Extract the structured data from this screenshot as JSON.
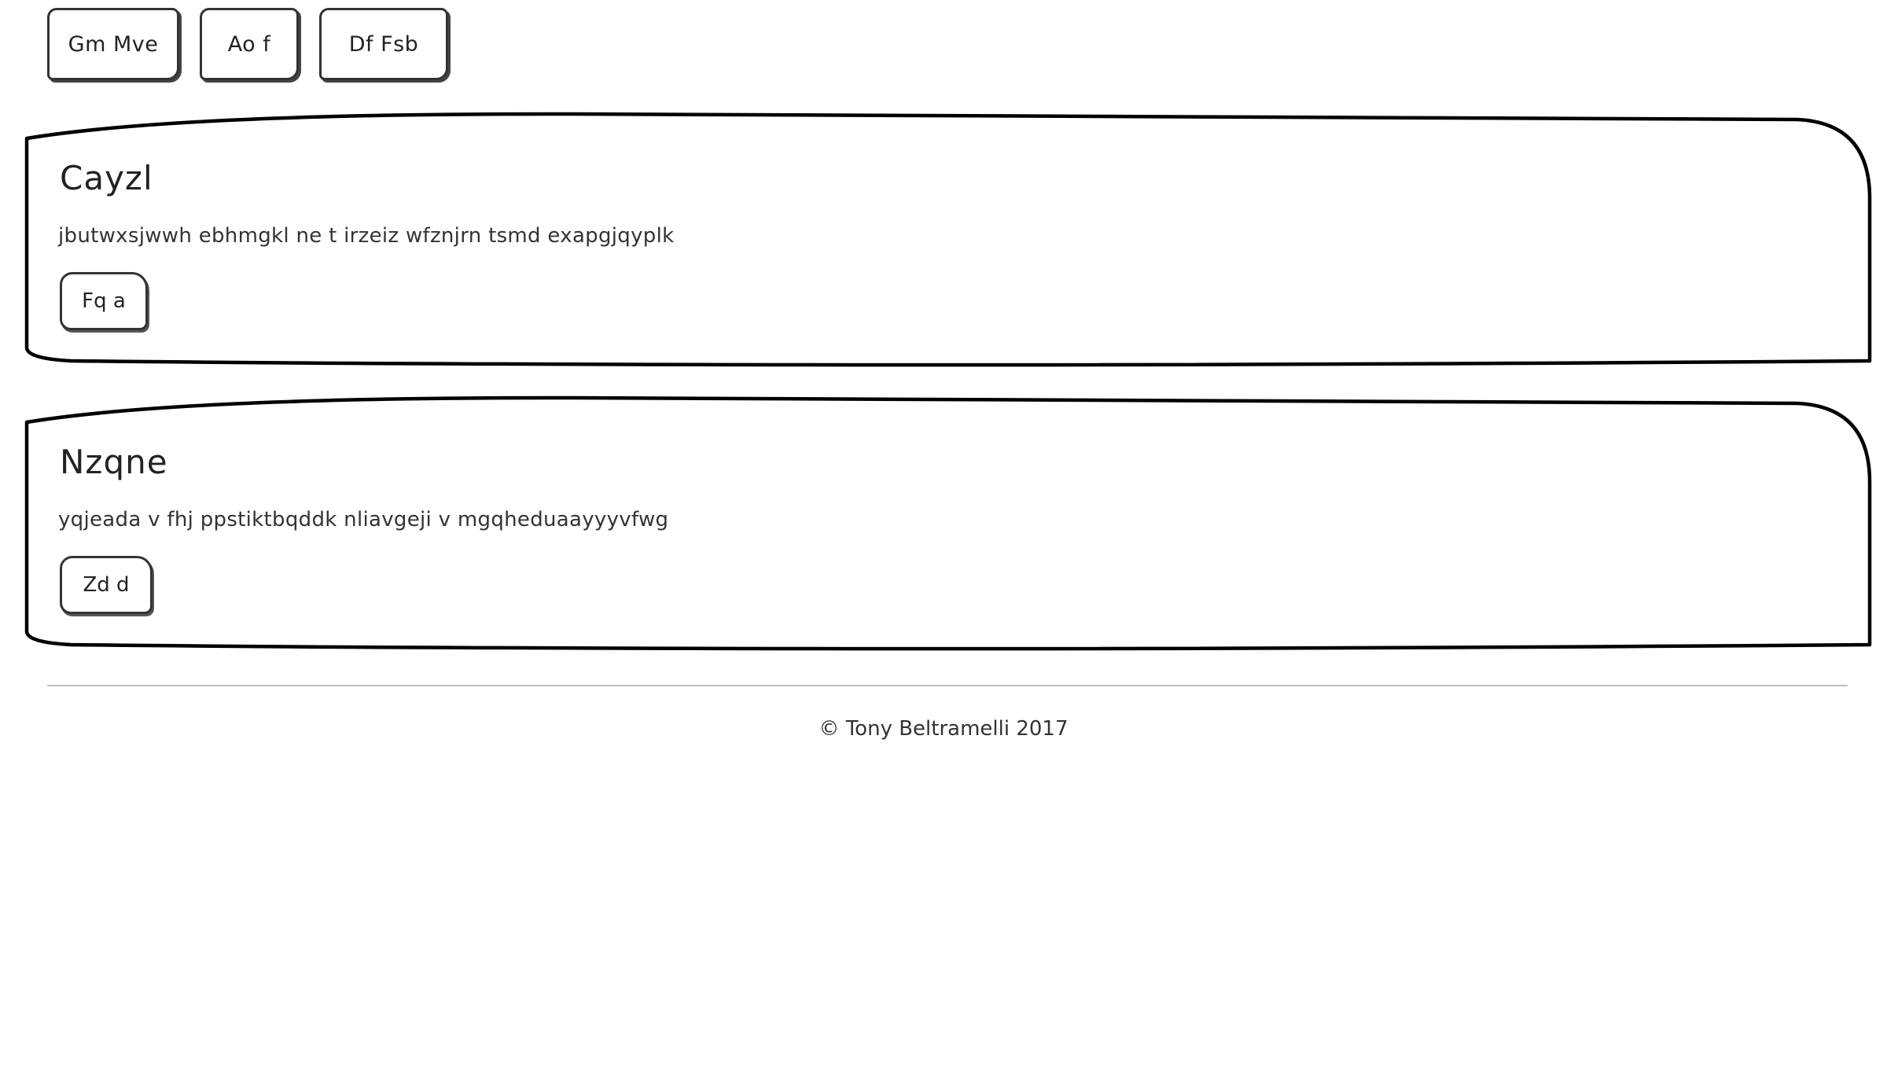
{
  "nav": {
    "items": [
      {
        "label": "Gm Mve"
      },
      {
        "label": "Ao f"
      },
      {
        "label": "Df Fsb"
      }
    ]
  },
  "cards": [
    {
      "title": "Cayzl",
      "text": "jbutwxsjwwh ebhmgkl ne t irzeiz wfznjrn tsmd exapgjqyplk",
      "button": "Fq a"
    },
    {
      "title": "Nzqne",
      "text": "yqjeada v fhj ppstiktbqddk nliavgeji v mgqheduaayyyvfwg",
      "button": "Zd d"
    }
  ],
  "footer": {
    "text": "© Tony Beltramelli 2017"
  }
}
